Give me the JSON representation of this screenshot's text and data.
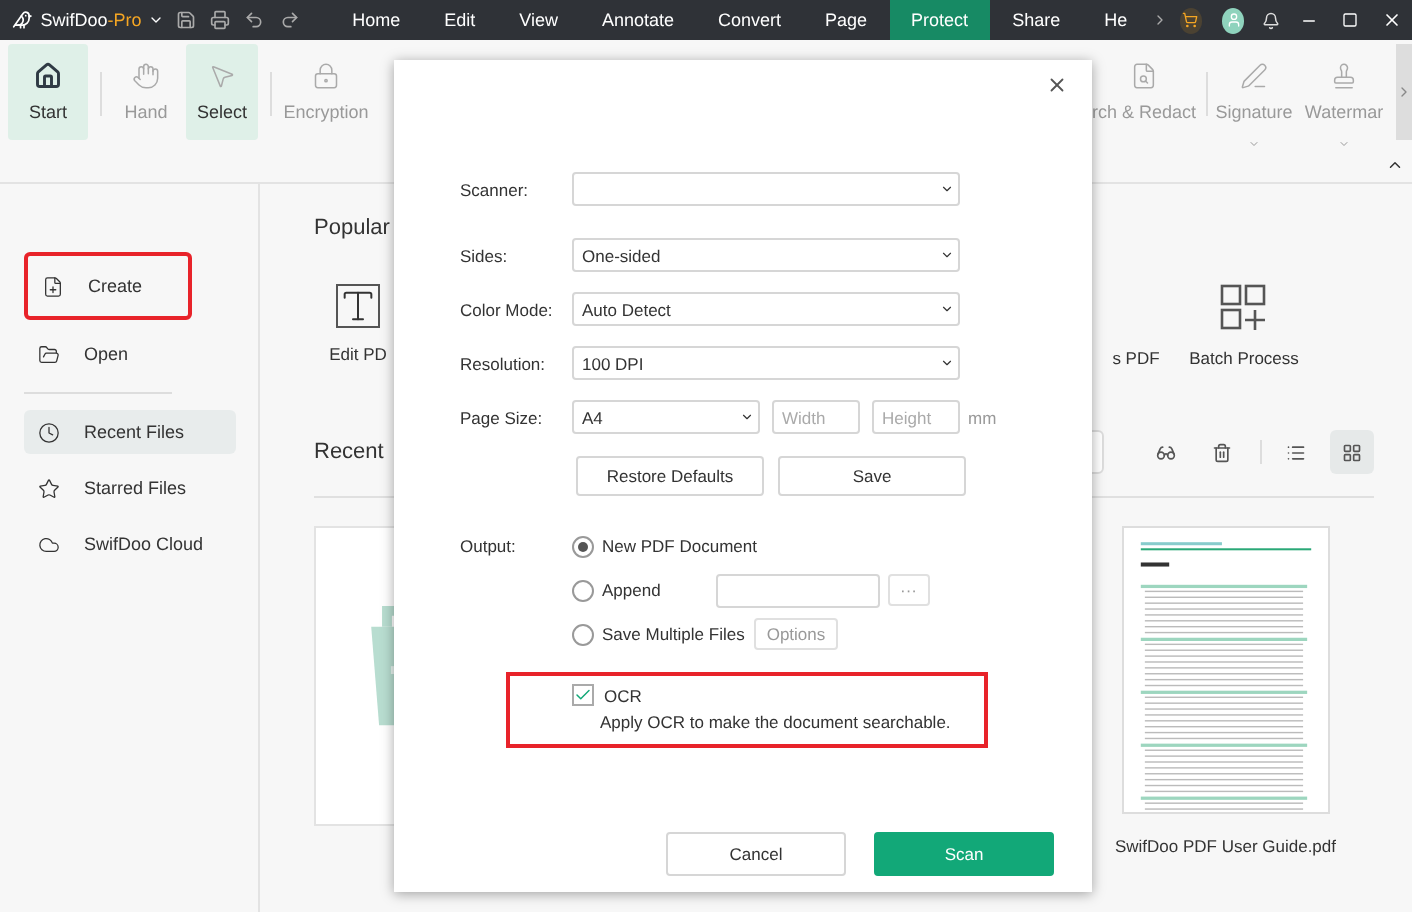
{
  "title_bar": {
    "app_name": "SwifDoo",
    "edition": "-Pro",
    "menu": [
      {
        "label": "Home",
        "selected": false
      },
      {
        "label": "Edit",
        "selected": false
      },
      {
        "label": "View",
        "selected": false
      },
      {
        "label": "Annotate",
        "selected": false
      },
      {
        "label": "Convert",
        "selected": false
      },
      {
        "label": "Page",
        "selected": false
      },
      {
        "label": "Protect",
        "selected": true
      },
      {
        "label": "Share",
        "selected": false
      },
      {
        "label": "He",
        "selected": false
      }
    ]
  },
  "ribbon": {
    "left": [
      {
        "label": "Start",
        "kind": "home",
        "selected": true
      },
      {
        "label": "Hand",
        "kind": "hand",
        "selected": false
      },
      {
        "label": "Select",
        "kind": "pointer",
        "selected": true
      },
      {
        "label": "Encryption",
        "kind": "lock",
        "selected": false
      }
    ],
    "right": [
      {
        "label": "rch & Redact",
        "kind": "search-doc",
        "selected": false
      },
      {
        "label": "Signature",
        "kind": "signature",
        "selected": false
      },
      {
        "label": "Watermar",
        "kind": "stamp",
        "selected": false
      }
    ]
  },
  "sidebar": {
    "items": [
      {
        "label": "Create",
        "kind": "create",
        "selected": false,
        "highlighted": true
      },
      {
        "label": "Open",
        "kind": "open",
        "selected": false,
        "highlighted": false
      },
      {
        "label": "Recent Files",
        "kind": "recent",
        "selected": true,
        "highlighted": false
      },
      {
        "label": "Starred Files",
        "kind": "star",
        "selected": false,
        "highlighted": false
      },
      {
        "label": "SwifDoo Cloud",
        "kind": "cloud",
        "selected": false,
        "highlighted": false
      }
    ]
  },
  "popular": {
    "title": "Popular",
    "tools": [
      {
        "label": "Edit PD",
        "kind": "text"
      },
      {
        "label": "s PDF",
        "kind": "none"
      },
      {
        "label": "Batch Process",
        "kind": "batch"
      }
    ]
  },
  "recent": {
    "title": "Recent",
    "views": [
      {
        "kind": "list",
        "selected": false
      },
      {
        "kind": "grid",
        "selected": true
      }
    ],
    "files": [
      {
        "kind": "picture"
      },
      {
        "kind": "document",
        "name": "SwifDoo PDF User Guide.pdf"
      }
    ]
  },
  "dialog": {
    "fields": [
      {
        "label": "Scanner:"
      },
      {
        "label": "Sides:",
        "value": "One-sided"
      },
      {
        "label": "Color Mode:",
        "value": "Auto Detect"
      },
      {
        "label": "Resolution:",
        "value": "100 DPI"
      }
    ],
    "page_size": {
      "label": "Page Size:",
      "value": "A4",
      "width_placeholder": "Width",
      "height_placeholder": "Height",
      "unit": "mm"
    },
    "buttons": [
      "Restore Defaults",
      "Save"
    ],
    "output": {
      "label": "Output:",
      "options": [
        {
          "label": "New PDF Document",
          "kind": "plain",
          "selected": true
        },
        {
          "label": "Append",
          "kind": "file",
          "selected": false,
          "browse": "···"
        },
        {
          "label": "Save Multiple Files",
          "kind": "options",
          "selected": false,
          "button": "Options"
        }
      ]
    },
    "ocr": {
      "label": "OCR",
      "checked": true,
      "highlighted": true,
      "description": "Apply OCR to make the document searchable."
    },
    "footer": [
      {
        "label": "Cancel",
        "primary": false
      },
      {
        "label": "Scan",
        "primary": true
      }
    ]
  }
}
